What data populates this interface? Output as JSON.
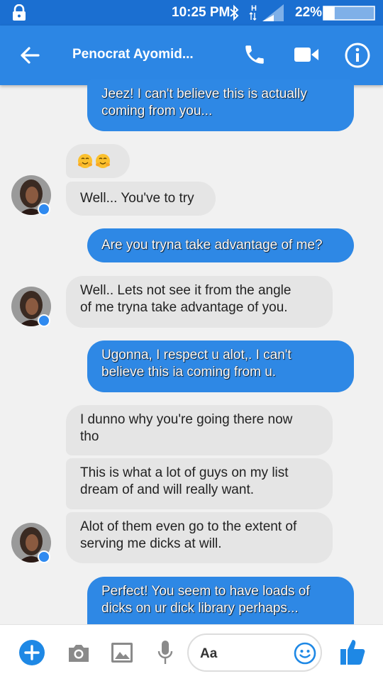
{
  "status_bar": {
    "time": "10:25 PM",
    "network": "H",
    "battery": "22%",
    "battery_level": 0.22
  },
  "header": {
    "contact_name": "Penocrat Ayomid..."
  },
  "messages": [
    {
      "side": "out",
      "text_lines": [
        "Jeez! I can't believe this is actually",
        "coming from you..."
      ]
    },
    {
      "side": "in",
      "emoji": [
        "hugging-face-emoji",
        "hugging-face-emoji"
      ]
    },
    {
      "side": "in",
      "text": "Well... You've to try"
    },
    {
      "side": "out",
      "text": "Are you tryna take advantage of me?"
    },
    {
      "side": "in",
      "text_lines": [
        "Well.. Lets not see it from the angle",
        "of me tryna take advantage of you."
      ]
    },
    {
      "side": "out",
      "text_lines": [
        "Ugonna, I respect u alot,.  I can't",
        "believe this ia coming from u."
      ]
    },
    {
      "side": "in",
      "text_lines": [
        "I dunno why you're going there now",
        "tho"
      ]
    },
    {
      "side": "in",
      "text_lines": [
        "This is what a lot of guys on my list",
        "dream of and will really want."
      ]
    },
    {
      "side": "in",
      "text_lines": [
        "Alot of them even go to the extent of",
        "serving me dicks at will."
      ]
    },
    {
      "side": "out",
      "text_lines": [
        "Perfect! You seem to have loads of",
        "dicks on ur dick library perhaps..."
      ]
    }
  ],
  "composer": {
    "placeholder": "Aa"
  },
  "icons": {
    "status": [
      "lock-icon",
      "bluetooth-icon",
      "signal-icon",
      "battery-icon"
    ],
    "header": [
      "back-arrow-icon",
      "phone-icon",
      "video-camera-icon",
      "info-icon"
    ],
    "composer": [
      "plus-icon",
      "camera-icon",
      "gallery-icon",
      "microphone-icon",
      "smiley-icon",
      "thumbs-up-icon"
    ]
  },
  "colors": {
    "header": "#2c86e4",
    "status_bar": "#1b6fd1",
    "outgoing_bubble": "#2e88e5",
    "incoming_bubble": "#e5e5e5",
    "accent": "#1e88e5"
  }
}
